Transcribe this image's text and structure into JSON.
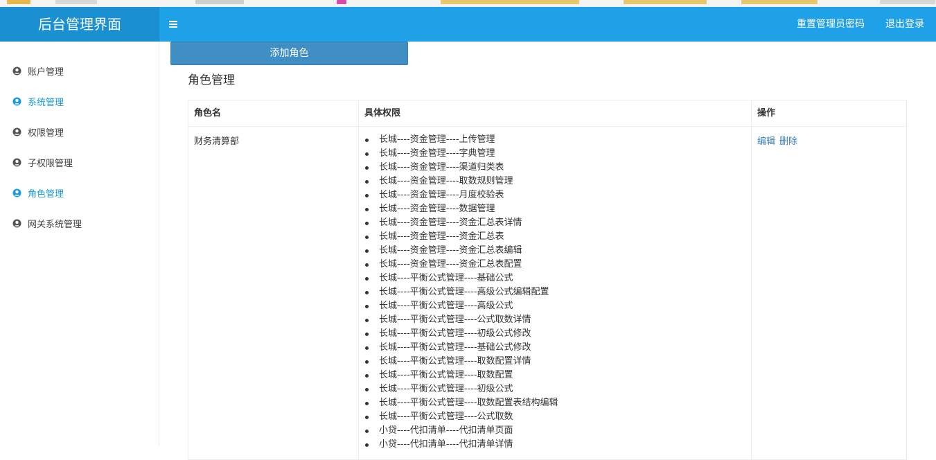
{
  "header": {
    "app_title": "后台管理界面",
    "reset_password": "重置管理员密码",
    "logout": "退出登录",
    "accent_color": "#1fa1e8"
  },
  "sidebar": {
    "items": [
      {
        "label": "账户管理",
        "icon": "user-circle-icon",
        "active": false
      },
      {
        "label": "系统管理",
        "icon": "user-circle-icon",
        "active": true
      },
      {
        "label": "权限管理",
        "icon": "user-circle-icon",
        "active": false
      },
      {
        "label": "子权限管理",
        "icon": "user-circle-icon",
        "active": false
      },
      {
        "label": "角色管理",
        "icon": "user-circle-icon",
        "active": true
      },
      {
        "label": "网关系统管理",
        "icon": "user-circle-icon",
        "active": false
      }
    ]
  },
  "main": {
    "add_button": "添加角色",
    "page_title": "角色管理",
    "table": {
      "headers": [
        "角色名",
        "具体权限",
        "操作"
      ],
      "rows": [
        {
          "name": "财务清算部",
          "permissions": [
            "长城----资金管理----上传管理",
            "长城----资金管理----字典管理",
            "长城----资金管理----渠道归类表",
            "长城----资金管理----取数规则管理",
            "长城----资金管理----月度校验表",
            "长城----资金管理----数据管理",
            "长城----资金管理----资金汇总表详情",
            "长城----资金管理----资金汇总表",
            "长城----资金管理----资金汇总表编辑",
            "长城----资金管理----资金汇总表配置",
            "长城----平衡公式管理----基础公式",
            "长城----平衡公式管理----高级公式编辑配置",
            "长城----平衡公式管理----高级公式",
            "长城----平衡公式管理----公式取数详情",
            "长城----平衡公式管理----初级公式修改",
            "长城----平衡公式管理----基础公式修改",
            "长城----平衡公式管理----取数配置详情",
            "长城----平衡公式管理----取数配置",
            "长城----平衡公式管理----初级公式",
            "长城----平衡公式管理----取数配置表结构编辑",
            "长城----平衡公式管理----公式取数",
            "小贷----代扣清单----代扣清单页面",
            "小贷----代扣清单----代扣清单详情"
          ],
          "actions": {
            "edit": "编辑",
            "delete": "删除"
          }
        }
      ]
    }
  }
}
